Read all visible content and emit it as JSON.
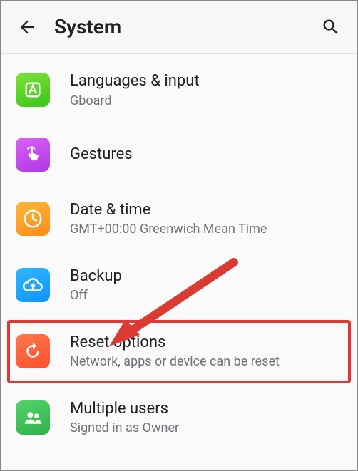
{
  "header": {
    "title": "System"
  },
  "items": [
    {
      "title": "Languages & input",
      "sub": "Gboard"
    },
    {
      "title": "Gestures",
      "sub": ""
    },
    {
      "title": "Date & time",
      "sub": "GMT+00:00 Greenwich Mean Time"
    },
    {
      "title": "Backup",
      "sub": "Off"
    },
    {
      "title": "Reset options",
      "sub": "Network, apps or device can be reset"
    },
    {
      "title": "Multiple users",
      "sub": "Signed in as Owner"
    }
  ],
  "highlight_index": 4,
  "colors": {
    "highlight": "#e53731",
    "arrow": "#db3a32"
  }
}
